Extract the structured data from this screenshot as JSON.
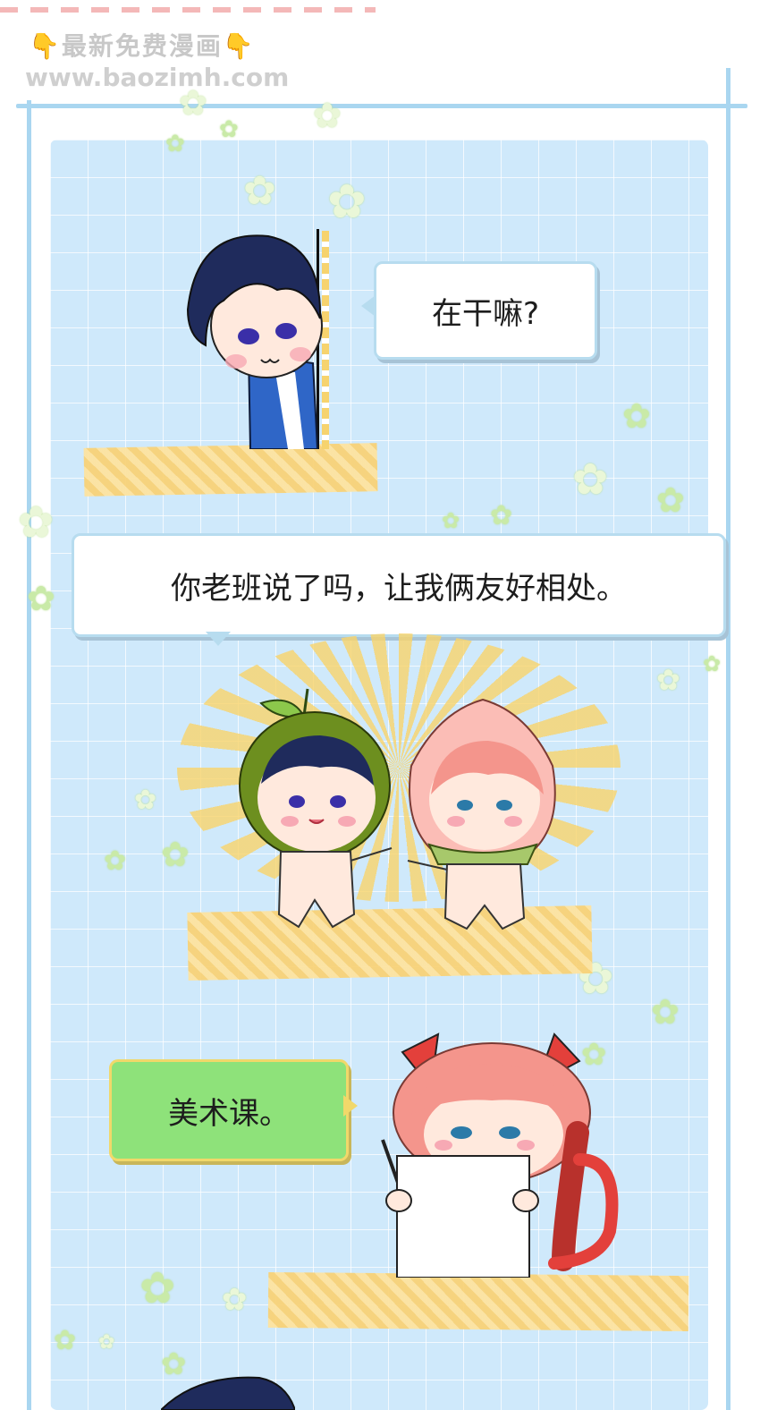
{
  "watermark": {
    "line1": "最新免费漫画",
    "hand_icon_left": "👇",
    "hand_icon_right": "👇",
    "line2": "www.baozimh.com"
  },
  "dialogue": {
    "bubble1": "在干嘛?",
    "bubble2": "你老班说了吗，让我俩友好相处。",
    "bubble3": "美术课。"
  },
  "colors": {
    "panel_bg": "#cfe9fb",
    "frame": "#a9d6f0",
    "green_bubble": "#8ee27a",
    "tape": "#fde3a0"
  }
}
